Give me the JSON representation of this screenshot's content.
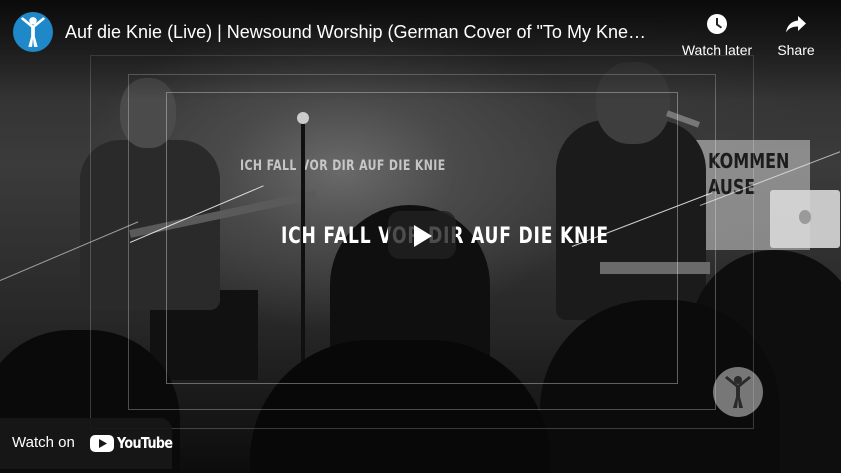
{
  "video": {
    "title": "Auf die Knie (Live) | Newsound Worship (German Cover of \"To My Knees\")",
    "lyric_caption": "ICH FALL VOR DIR AUF DIE KNIE",
    "background_lyric": "ICH FALL VOR DIR AUF DIE KNIE",
    "banner_text": "KOMMEN\nAUSE"
  },
  "channel": {
    "avatar_icon": "person-arms-raised-icon",
    "avatar_color": "#1e88c8"
  },
  "controls": {
    "watch_later_label": "Watch later",
    "watch_later_icon": "clock-icon",
    "share_label": "Share",
    "share_icon": "share-arrow-icon",
    "play_icon": "play-icon"
  },
  "footer": {
    "watch_on_label": "Watch on",
    "youtube_wordmark": "YouTube",
    "youtube_icon": "youtube-logo-icon"
  }
}
